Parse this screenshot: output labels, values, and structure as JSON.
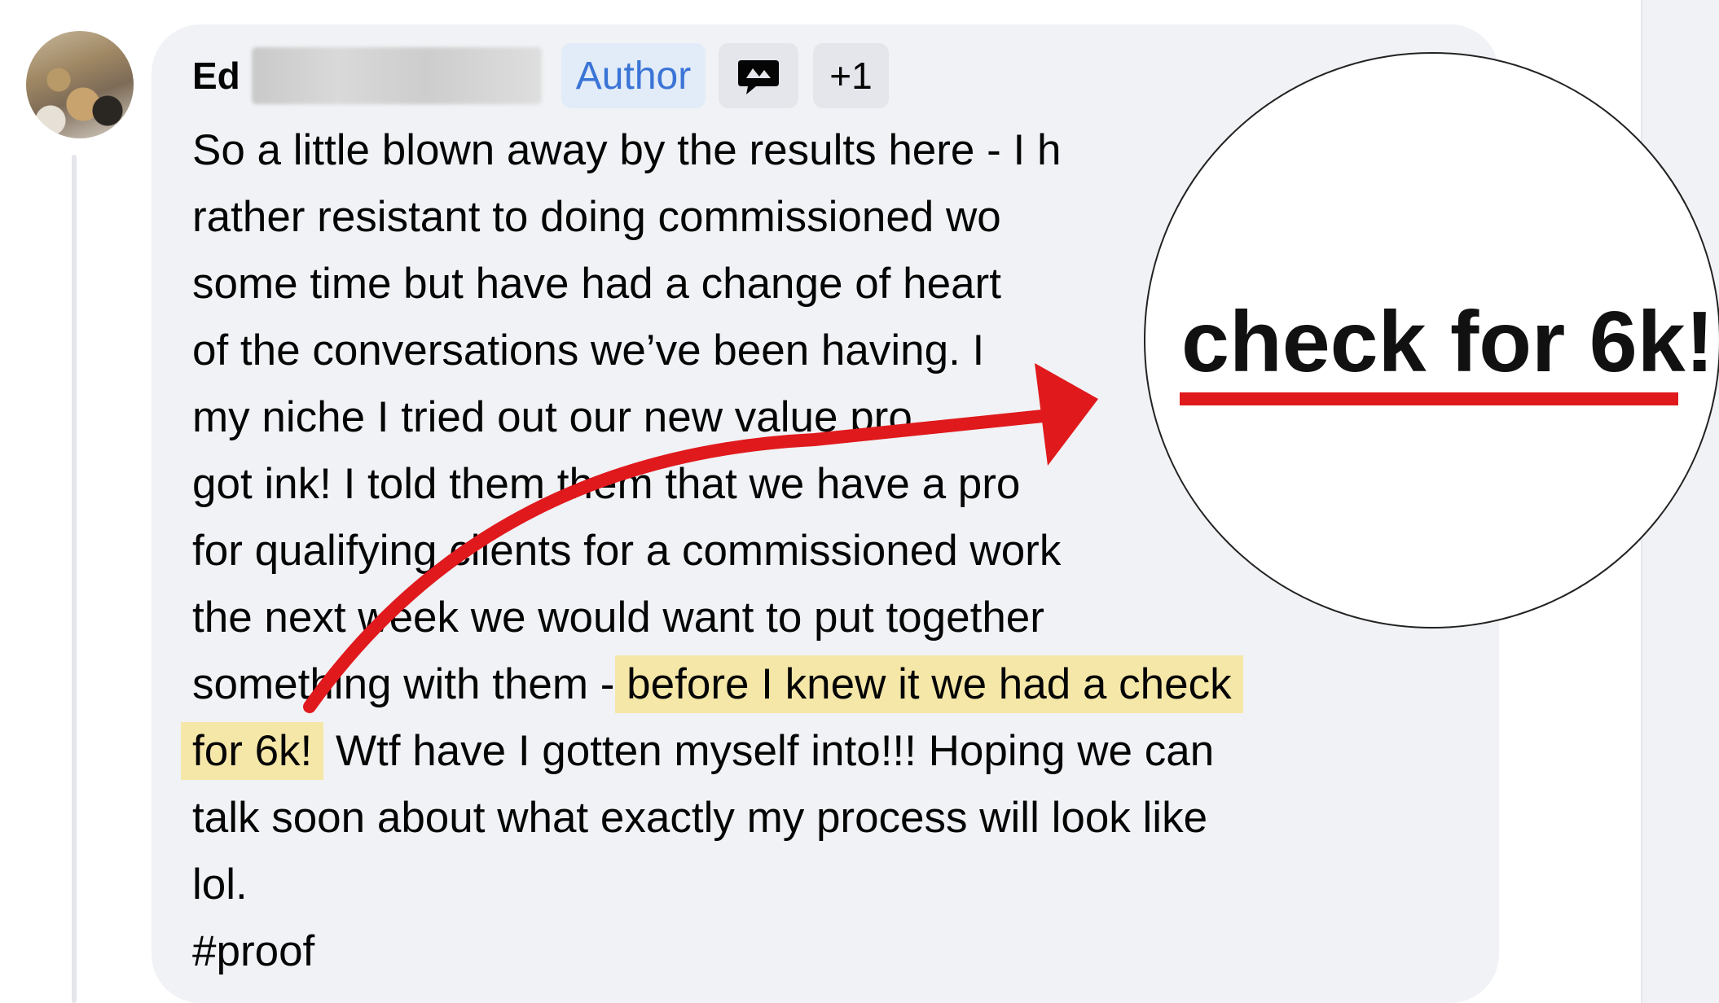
{
  "comment": {
    "author": "Ed",
    "author_badge": "Author",
    "badge_icon": "speech-bubble-icon",
    "extra_badges": "+1",
    "body_lines": [
      "So a little blown away by the results here - I h",
      "rather resistant to doing commissioned wo",
      "some time but have had a change of heart",
      "of the conversations we’ve been having. I",
      "my niche I tried out our new value pro",
      "got ink! I told them them that we have a pro",
      "for qualifying clients for a commissioned work",
      "the next week we would want to put together"
    ],
    "line9_prefix": "something with them - ",
    "line9_highlight": "before I knew it we had a check",
    "line10_highlight": "for 6k!",
    "line10_rest": " Wtf have I gotten myself into!!! Hoping we can",
    "line11": "talk soon about what exactly my process will look like",
    "line12": "lol.",
    "hashtag": "#proof"
  },
  "callout": {
    "zoom_text": "check for 6k!",
    "arrow_color": "#e0191c",
    "highlight_color": "#f5e7a8"
  }
}
